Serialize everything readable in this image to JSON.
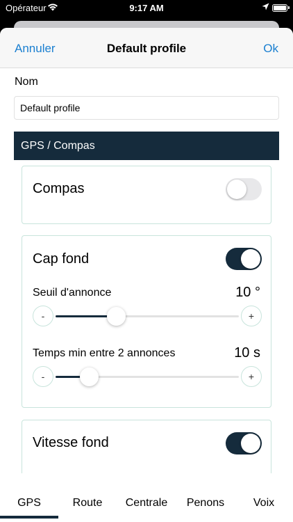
{
  "status_bar": {
    "carrier": "Opérateur",
    "time": "9:17 AM"
  },
  "navbar": {
    "cancel_label": "Annuler",
    "title": "Default profile",
    "ok_label": "Ok"
  },
  "form": {
    "name_label": "Nom",
    "name_value": "Default profile"
  },
  "section": {
    "title": "GPS / Compas"
  },
  "compas_card": {
    "title": "Compas",
    "enabled": false
  },
  "cap_fond_card": {
    "title": "Cap fond",
    "enabled": true,
    "threshold": {
      "label": "Seuil d'annonce",
      "value_text": "10 °",
      "level": 0.33,
      "minus": "-",
      "plus": "+"
    },
    "min_time": {
      "label": "Temps min entre 2 annonces",
      "value_text": "10 s",
      "level": 0.18,
      "minus": "-",
      "plus": "+"
    }
  },
  "vitesse_card": {
    "title": "Vitesse fond",
    "enabled": true
  },
  "tabs": [
    {
      "label": "GPS",
      "active": true
    },
    {
      "label": "Route",
      "active": false
    },
    {
      "label": "Centrale",
      "active": false
    },
    {
      "label": "Penons",
      "active": false
    },
    {
      "label": "Voix",
      "active": false
    }
  ],
  "colors": {
    "accent": "#152b3c",
    "link": "#1a7fd0",
    "card_border": "#c8e4dc"
  }
}
